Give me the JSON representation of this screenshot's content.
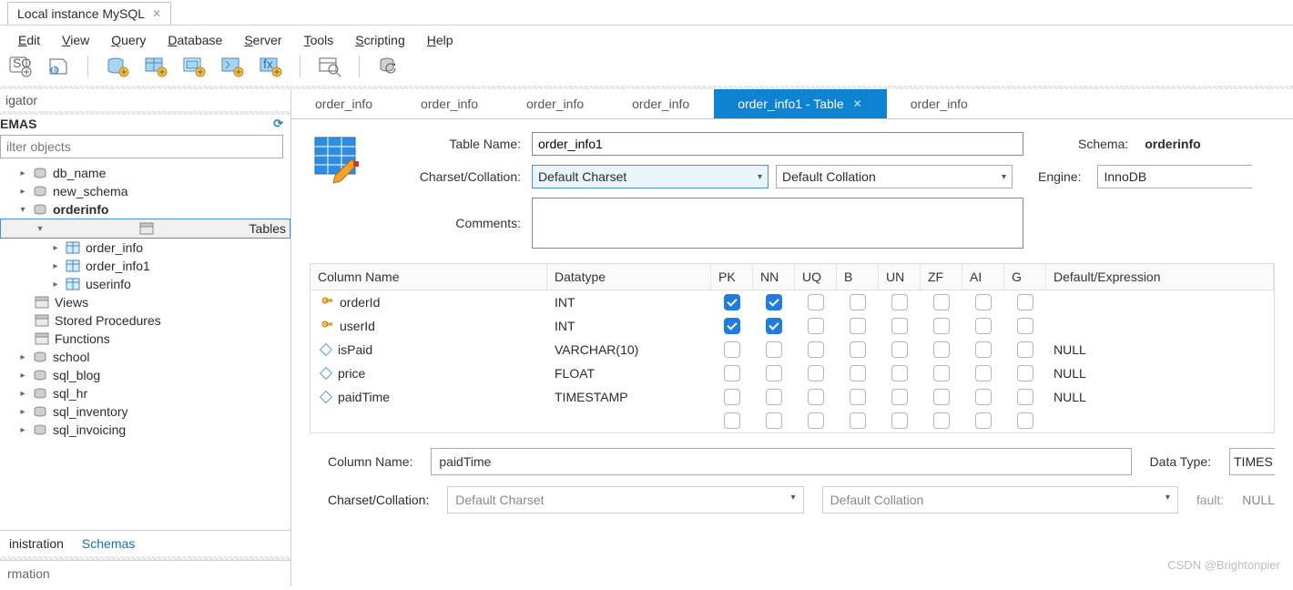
{
  "window_tab": {
    "title": "Local instance MySQL"
  },
  "menubar": [
    "Edit",
    "View",
    "Query",
    "Database",
    "Server",
    "Tools",
    "Scripting",
    "Help"
  ],
  "navigator_label": "igator",
  "schemas_label": "EMAS",
  "filter_placeholder": "ilter objects",
  "tree": {
    "dbs": [
      "db_name",
      "new_schema"
    ],
    "active_db": "orderinfo",
    "tables_label": "Tables",
    "tables": [
      "order_info",
      "order_info1",
      "userinfo"
    ],
    "folders": [
      "Views",
      "Stored Procedures",
      "Functions"
    ],
    "other_dbs": [
      "school",
      "sql_blog",
      "sql_hr",
      "sql_inventory",
      "sql_invoicing"
    ]
  },
  "sidebar_tabs": {
    "admin": "inistration",
    "schemas": "Schemas"
  },
  "sidebar_section": "rmation",
  "editor_tabs": {
    "inactive": [
      "order_info",
      "order_info",
      "order_info",
      "order_info"
    ],
    "active": "order_info1 - Table",
    "trailing": "order_info"
  },
  "form": {
    "table_name_label": "Table Name:",
    "table_name_value": "order_info1",
    "schema_label": "Schema:",
    "schema_value": "orderinfo",
    "charset_label": "Charset/Collation:",
    "charset_value": "Default Charset",
    "collation_value": "Default Collation",
    "engine_label": "Engine:",
    "engine_value": "InnoDB",
    "comments_label": "Comments:"
  },
  "columns_header": [
    "Column Name",
    "Datatype",
    "PK",
    "NN",
    "UQ",
    "B",
    "UN",
    "ZF",
    "AI",
    "G",
    "Default/Expression"
  ],
  "columns": [
    {
      "name": "orderId",
      "datatype": "INT",
      "pk": true,
      "nn": true,
      "uq": false,
      "b": false,
      "un": false,
      "zf": false,
      "ai": false,
      "g": false,
      "def": "",
      "key": true
    },
    {
      "name": "userId",
      "datatype": "INT",
      "pk": true,
      "nn": true,
      "uq": false,
      "b": false,
      "un": false,
      "zf": false,
      "ai": false,
      "g": false,
      "def": "",
      "key": true
    },
    {
      "name": "isPaid",
      "datatype": "VARCHAR(10)",
      "pk": false,
      "nn": false,
      "uq": false,
      "b": false,
      "un": false,
      "zf": false,
      "ai": false,
      "g": false,
      "def": "NULL",
      "key": false
    },
    {
      "name": "price",
      "datatype": "FLOAT",
      "pk": false,
      "nn": false,
      "uq": false,
      "b": false,
      "un": false,
      "zf": false,
      "ai": false,
      "g": false,
      "def": "NULL",
      "key": false
    },
    {
      "name": "paidTime",
      "datatype": "TIMESTAMP",
      "pk": false,
      "nn": false,
      "uq": false,
      "b": false,
      "un": false,
      "zf": false,
      "ai": false,
      "g": false,
      "def": "NULL",
      "key": false
    }
  ],
  "detail": {
    "colname_label": "Column Name:",
    "colname_value": "paidTime",
    "datatype_label": "Data Type:",
    "datatype_value": "TIMES",
    "charset_label": "Charset/Collation:",
    "charset_value": "Default Charset",
    "collation_value": "Default Collation",
    "fault_label": "fault:",
    "fault_value": "NULL"
  },
  "watermark": "CSDN @Brightonpier"
}
